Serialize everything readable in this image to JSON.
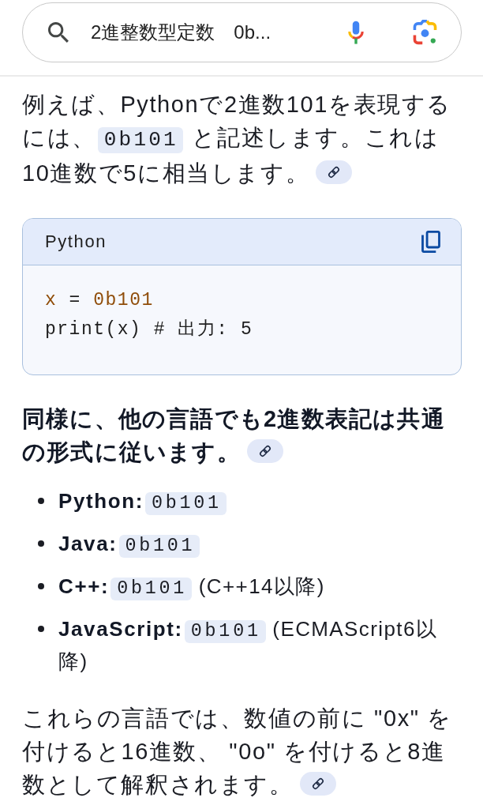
{
  "search_bar": {
    "query": "2進整数型定数　0b..."
  },
  "content": [
    {
      "kind": "paragraph",
      "parts": [
        {
          "kind": "text",
          "text": "例えば、Pythonで2進数101を表現するには、"
        },
        {
          "kind": "code",
          "text": "0b101"
        },
        {
          "kind": "text",
          "text": " と記述します。これは10進数で5に相当します。"
        },
        {
          "kind": "source_link"
        }
      ]
    },
    {
      "kind": "code_block",
      "language": "Python",
      "lines": [
        [
          {
            "kind": "name",
            "text": "x"
          },
          {
            "kind": "plain",
            "text": " = "
          },
          {
            "kind": "number",
            "text": "0b101"
          }
        ],
        [
          {
            "kind": "plain",
            "text": "print(x) # 出力: 5"
          }
        ]
      ]
    },
    {
      "kind": "heading",
      "parts": [
        {
          "kind": "text",
          "text": "同様に、他の言語でも2進数表記は共通の形式に従います。"
        },
        {
          "kind": "source_link"
        }
      ]
    },
    {
      "kind": "list",
      "items": [
        {
          "parts": [
            {
              "kind": "bold",
              "text": "Python:"
            },
            {
              "kind": "code",
              "text": "0b101"
            }
          ]
        },
        {
          "parts": [
            {
              "kind": "bold",
              "text": "Java:"
            },
            {
              "kind": "code",
              "text": "0b101"
            }
          ]
        },
        {
          "parts": [
            {
              "kind": "bold",
              "text": "C++:"
            },
            {
              "kind": "code",
              "text": "0b101"
            },
            {
              "kind": "text",
              "text": " (C++14以降)"
            }
          ]
        },
        {
          "parts": [
            {
              "kind": "bold",
              "text": "JavaScript:"
            },
            {
              "kind": "code",
              "text": "0b101"
            },
            {
              "kind": "text",
              "text": " (ECMAScript6以降)"
            }
          ]
        }
      ]
    },
    {
      "kind": "paragraph",
      "parts": [
        {
          "kind": "text",
          "text": "これらの言語では、数値の前に \"0x\" を付けると16進数、 \"0o\" を付けると8進数として解釈されます。"
        },
        {
          "kind": "source_link"
        }
      ]
    }
  ]
}
